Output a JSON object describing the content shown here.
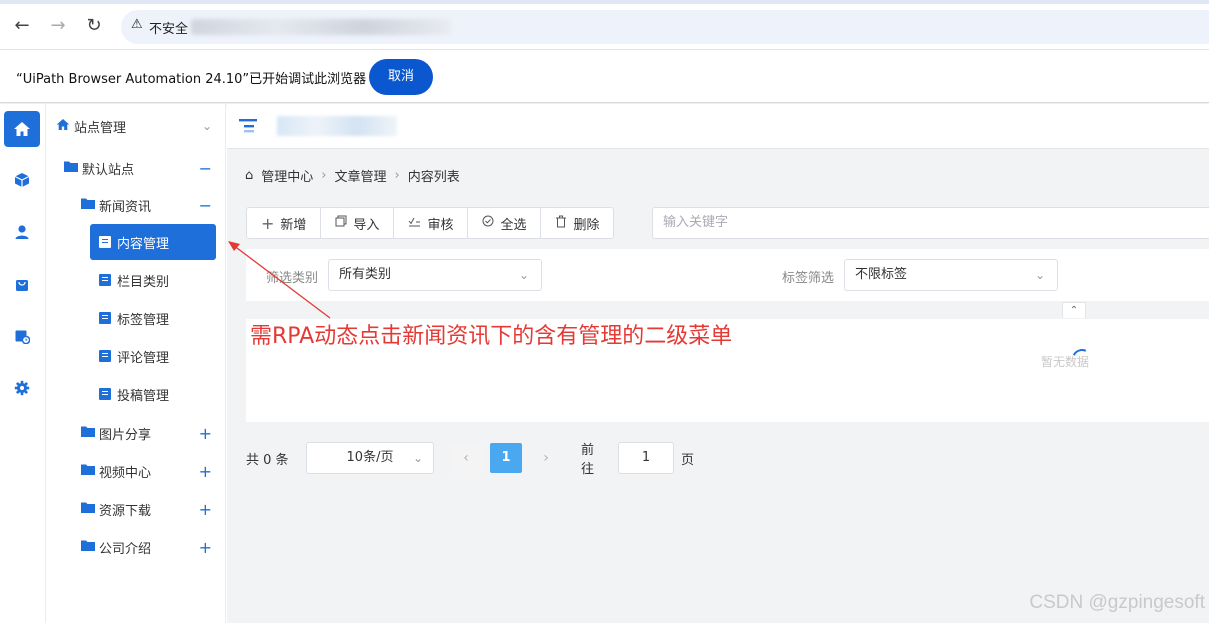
{
  "browser": {
    "security_label": "不安全",
    "url_text": "不安全"
  },
  "infobar": {
    "message": "“UiPath Browser Automation 24.10”已开始调试此浏览器",
    "cancel_label": "取消",
    "cancel_color": "#0b57d0"
  },
  "rail": {
    "items": [
      "home-icon",
      "cube-icon",
      "user-icon",
      "bag-icon",
      "calendar-icon",
      "gear-icon"
    ]
  },
  "tree": {
    "root": "站点管理",
    "site": "默认站点",
    "site_ctrl": "−",
    "news": "新闻资讯",
    "news_ctrl": "−",
    "news_children": [
      "内容管理",
      "栏目类别",
      "标签管理",
      "评论管理",
      "投稿管理"
    ],
    "others": [
      {
        "label": "图片分享",
        "ctrl": "+"
      },
      {
        "label": "视频中心",
        "ctrl": "+"
      },
      {
        "label": "资源下载",
        "ctrl": "+"
      },
      {
        "label": "公司介绍",
        "ctrl": "+"
      }
    ]
  },
  "breadcrumb": [
    "管理中心",
    "文章管理",
    "内容列表"
  ],
  "toolbar": {
    "add": "新增",
    "import": "导入",
    "review": "审核",
    "select_all": "全选",
    "delete": "删除"
  },
  "search": {
    "placeholder": "输入关键字"
  },
  "filters": {
    "category_label": "筛选类别",
    "category_value": "所有类别",
    "tag_label": "标签筛选",
    "tag_value": "不限标签"
  },
  "table": {
    "empty_text": "暂无数据"
  },
  "pager": {
    "total": "共 0 条",
    "page_size": "10条/页",
    "current_page": "1",
    "goto_label": "前往",
    "goto_value": "1",
    "page_unit": "页"
  },
  "annotation": {
    "text": "需RPA动态点击新闻资讯下的含有管理的二级菜单",
    "color": "#e53935"
  },
  "watermark": "CSDN @gzpingesoft",
  "colors": {
    "primary": "#1e6fd9",
    "page_active": "#4aa8f0"
  }
}
